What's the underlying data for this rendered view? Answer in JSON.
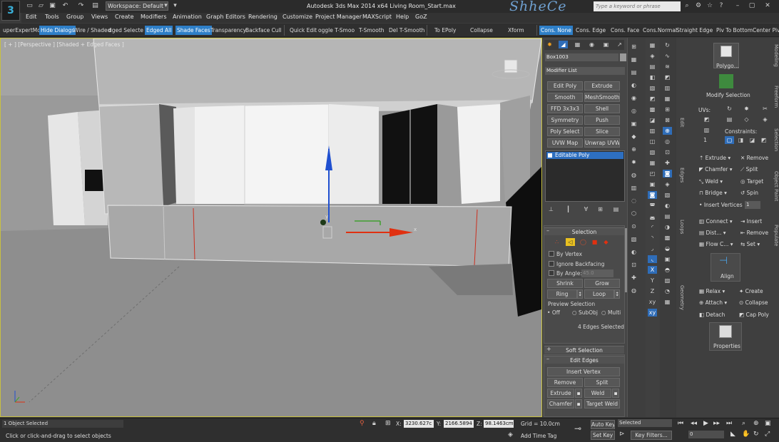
{
  "app": {
    "workspace": "Workspace: Default",
    "title": "Autodesk 3ds Max  2014 x64     Living Room_Start.max",
    "brand": "ShheCe",
    "search_placeholder": "Type a keyword or phrase"
  },
  "menu": [
    "Edit",
    "Tools",
    "Group",
    "Views",
    "Create",
    "Modifiers",
    "Animation",
    "Graph Editors",
    "Rendering",
    "Customize",
    "Project Manager",
    "MAXScript",
    "Help",
    "GoZ"
  ],
  "ribbon": {
    "left": [
      "uperExpertMo",
      "Hide Dialogs",
      "Wire / Shaded",
      "dged Selecte",
      "Edged All",
      "Shade Faces",
      "Transparency",
      "Backface Cull",
      "Quick Edit",
      "oggle T-Smoo",
      "T-Smooth",
      "Del T-Smooth",
      "To  EPoly",
      "Collapse",
      "Xform"
    ],
    "right": [
      "Cons. None",
      "Cons. Edge",
      "Cons. Face",
      "Cons.Normal",
      "Straight Edge",
      "Piv To Bottom",
      "Center Pivo"
    ]
  },
  "viewport": {
    "label": "[ + ] [Perspective ] [Shaded + Edged Faces ]",
    "gizmo_axes": {
      "x": "x",
      "y": "y"
    }
  },
  "command_panel": {
    "object_name": "Box1003",
    "modifier_list": "Modifier List",
    "modifier_buttons": [
      "Edit Poly",
      "Extrude",
      "Smooth",
      "MeshSmooth",
      "FFD 3x3x3",
      "Shell",
      "Symmetry",
      "Push",
      "Poly Select",
      "Slice",
      "UVW Map",
      "Unwrap UVW"
    ],
    "stack_item": "Editable Poly",
    "selection": {
      "header": "Selection",
      "by_vertex": "By Vertex",
      "ignore_backfacing": "Ignore Backfacing",
      "by_angle": "By Angle:",
      "angle_value": "45.0",
      "shrink": "Shrink",
      "grow": "Grow",
      "ring": "Ring",
      "loop": "Loop",
      "preview_selection": "Preview Selection",
      "preview_options": [
        "Off",
        "SubObj",
        "Multi"
      ],
      "selected_info": "4 Edges Selected"
    },
    "soft_selection": "Soft Selection",
    "edit_edges": {
      "header": "Edit Edges",
      "insert_vertex": "Insert Vertex",
      "remove": "Remove",
      "split": "Split",
      "extrude": "Extrude",
      "weld": "Weld",
      "chamfer": "Chamfer",
      "target_weld": "Target Weld"
    }
  },
  "right_ribbon": {
    "polygon": "Polygo...",
    "modify_selection": "Modify Selection",
    "uvs": "UVs:",
    "constraints": "Constraints:",
    "tabs": [
      "Edit",
      "Edges",
      "Loops",
      "Geometry"
    ],
    "edges_tools": [
      {
        "a": "Extrude",
        "b": "Remove"
      },
      {
        "a": "Chamfer",
        "b": "Split"
      },
      {
        "a": "Weld",
        "b": "Target"
      },
      {
        "a": "Bridge",
        "b": "Spin"
      }
    ],
    "insert_vertices": "Insert Vertices",
    "insert_value": "1",
    "loops_tools": [
      {
        "a": "Connect",
        "b": "Insert"
      },
      {
        "a": "Dist...",
        "b": "Remove"
      },
      {
        "a": "Flow C...",
        "b": "Set"
      }
    ],
    "align": "Align",
    "geometry_tools": [
      {
        "a": "Relax",
        "b": "Create"
      },
      {
        "a": "Attach",
        "b": "Collapse"
      },
      {
        "a": "Detach",
        "b": "Cap Poly"
      }
    ],
    "properties": "Properties",
    "side_labels": [
      "Modeling",
      "Freeform",
      "Selection",
      "Object Paint",
      "Populate"
    ]
  },
  "status": {
    "selected": "1 Object Selected",
    "prompt": "Click or click-and-drag to select objects",
    "x": "3230.627c",
    "y": "2166.5894",
    "z": "98.1463cm",
    "grid": "Grid = 10.0cm",
    "add_time_tag": "Add Time Tag",
    "auto_key": "Auto Key",
    "set_key": "Set Key",
    "key_mode": "Selected",
    "key_filters": "Key Filters...",
    "frame": "0"
  },
  "colors": {
    "accent": "#2e7fc8",
    "viewport_border": "#c8c040",
    "gizmo_red": "#e03010",
    "gizmo_blue": "#2050d0",
    "gizmo_green": "#40a030"
  }
}
